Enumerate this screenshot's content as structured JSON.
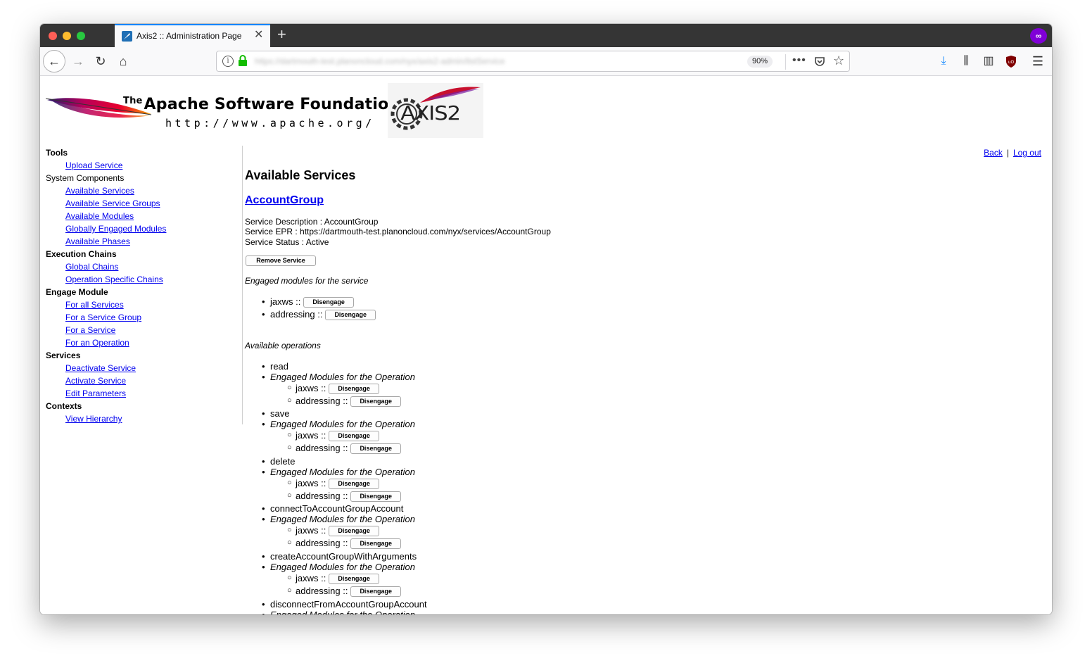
{
  "browser": {
    "tab_title": "Axis2 :: Administration Page",
    "tab_close": "✕",
    "new_tab": "+",
    "url": "https://dartmouth-test.planoncloud.com/nyx/axis2-admin/listService",
    "zoom": "90%",
    "more_actions": "•••",
    "bookmark_star": "☆"
  },
  "banner": {
    "asf_the": "The",
    "asf_title": "Apache Software Foundation",
    "asf_url": "http://www.apache.org/",
    "axis_logo_text": "AXIS2"
  },
  "toplinks": {
    "back": "Back",
    "separator": "|",
    "logout": "Log out"
  },
  "sidebar": {
    "sections": [
      {
        "heading": "Tools",
        "bold": true,
        "links": [
          "Upload Service"
        ]
      },
      {
        "heading": "System Components",
        "bold": false,
        "links": [
          "Available Services",
          "Available Service Groups",
          "Available Modules",
          "Globally Engaged Modules",
          "Available Phases"
        ]
      },
      {
        "heading": "Execution Chains",
        "bold": true,
        "links": [
          "Global Chains",
          "Operation Specific Chains"
        ]
      },
      {
        "heading": "Engage Module",
        "bold": true,
        "links": [
          "For all Services",
          "For a Service Group",
          "For a Service",
          "For an Operation"
        ]
      },
      {
        "heading": "Services",
        "bold": true,
        "links": [
          "Deactivate Service",
          "Activate Service",
          "Edit Parameters"
        ]
      },
      {
        "heading": "Contexts",
        "bold": true,
        "links": [
          "View Hierarchy"
        ]
      }
    ]
  },
  "main": {
    "title": "Available Services",
    "service_name": "AccountGroup",
    "service_description": "Service Description : AccountGroup",
    "service_epr": "Service EPR : https://dartmouth-test.planoncloud.com/nyx/services/AccountGroup",
    "service_status": "Service Status : Active",
    "remove_button": "Remove Service",
    "engaged_modules_heading": "Engaged modules for the service",
    "engaged_modules": [
      "jaxws ::",
      "addressing ::"
    ],
    "disengage_label": "Disengage",
    "available_operations_heading": "Available operations",
    "op_modules_heading": "Engaged Modules for the Operation",
    "op_modules": [
      "jaxws ::",
      "addressing ::"
    ],
    "operations": [
      "read",
      "save",
      "delete",
      "connectToAccountGroupAccount",
      "createAccountGroupWithArguments",
      "disconnectFromAccountGroupAccount"
    ]
  }
}
